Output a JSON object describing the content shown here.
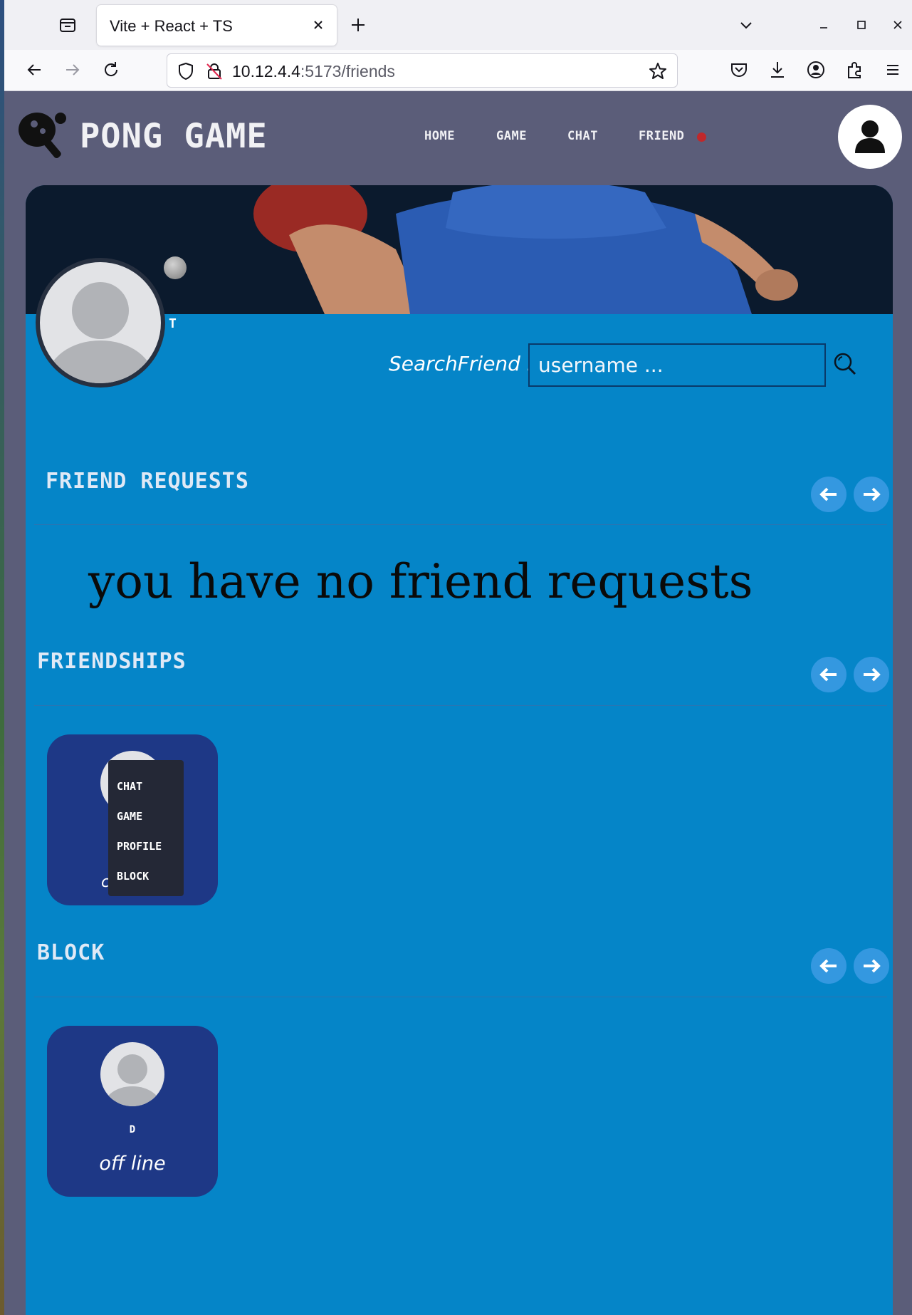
{
  "browser": {
    "tab_title": "Vite + React + TS",
    "url_host": "10.12.4.4",
    "url_rest": ":5173/friends"
  },
  "app": {
    "brand": "PONG GAME",
    "menu": [
      "HOME",
      "GAME",
      "CHAT",
      "FRIEND"
    ],
    "friend_notification": true
  },
  "profile": {
    "username": "T"
  },
  "search": {
    "label": "SearchFriend :",
    "placeholder": "username ..."
  },
  "sections": {
    "requests": {
      "title": "FRIEND REQUESTS",
      "empty_message": "you have no friend requests"
    },
    "friendships": {
      "title": "FRIENDSHIPS",
      "friends": [
        {
          "initial": "c"
        }
      ],
      "context_menu": [
        "CHAT",
        "GAME",
        "PROFILE",
        "BLOCK"
      ]
    },
    "block": {
      "title": "BLOCK",
      "users": [
        {
          "name": "D",
          "status": "off line"
        }
      ]
    }
  },
  "colors": {
    "page_bg": "#5b5d79",
    "content_bg": "#0585c8",
    "card_bg": "#1e3886",
    "arrow_btn": "#3498e0",
    "notification": "#c0282b",
    "context_menu_bg": "#242836"
  },
  "icons": {
    "logo": "ping-pong-paddle-icon",
    "user": "user-icon",
    "search": "search-icon",
    "prev": "arrow-left-icon",
    "next": "arrow-right-icon"
  }
}
